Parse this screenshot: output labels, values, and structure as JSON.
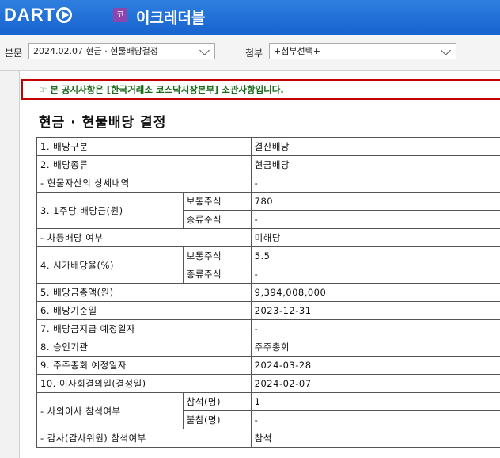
{
  "header": {
    "logo_text": "DART",
    "company_badge": "코",
    "company_name": "이크레더블"
  },
  "toolbar": {
    "main_label": "본문",
    "main_value": "2024.02.07  현금 · 현물배당결정",
    "attach_label": "첨부",
    "attach_value": "+첨부선택+"
  },
  "notice": {
    "icon": "pointing-hand-icon",
    "hand": "☞",
    "text": "본 공시사항은 [한국거래소 코스닥시장본부] 소관사항입니다."
  },
  "document": {
    "title": "현금 · 현물배당 결정",
    "rows": {
      "r1": {
        "label": "1. 배당구분",
        "value": "결산배당"
      },
      "r2": {
        "label": "2. 배당종류",
        "value": "현금배당"
      },
      "r3": {
        "label": "- 현물자산의 상세내역",
        "value": "-"
      },
      "r4": {
        "label": "3. 1주당 배당금(원)",
        "sub1": "보통주식",
        "val1": "780",
        "sub2": "종류주식",
        "val2": "-"
      },
      "r5": {
        "label": "- 차등배당 여부",
        "value": "미해당"
      },
      "r6": {
        "label": "4. 시가배당율(%)",
        "sub1": "보통주식",
        "val1": "5.5",
        "sub2": "종류주식",
        "val2": "-"
      },
      "r7": {
        "label": "5. 배당금총액(원)",
        "value": "9,394,008,000"
      },
      "r8": {
        "label": "6. 배당기준일",
        "value": "2023-12-31"
      },
      "r9": {
        "label": "7. 배당금지급 예정일자",
        "value": "-"
      },
      "r10": {
        "label": "8. 승인기관",
        "value": "주주총회"
      },
      "r11": {
        "label": "9. 주주총회 예정일자",
        "value": "2024-03-28"
      },
      "r12": {
        "label": "10. 이사회결의일(결정일)",
        "value": "2024-02-07"
      },
      "r13": {
        "label": "- 사외이사 참석여부",
        "sub1": "참석(명)",
        "val1": "1",
        "sub2": "불참(명)",
        "val2": "-"
      },
      "r14": {
        "label": "- 감사(감사위원) 참석여부",
        "value": "참석"
      }
    }
  }
}
